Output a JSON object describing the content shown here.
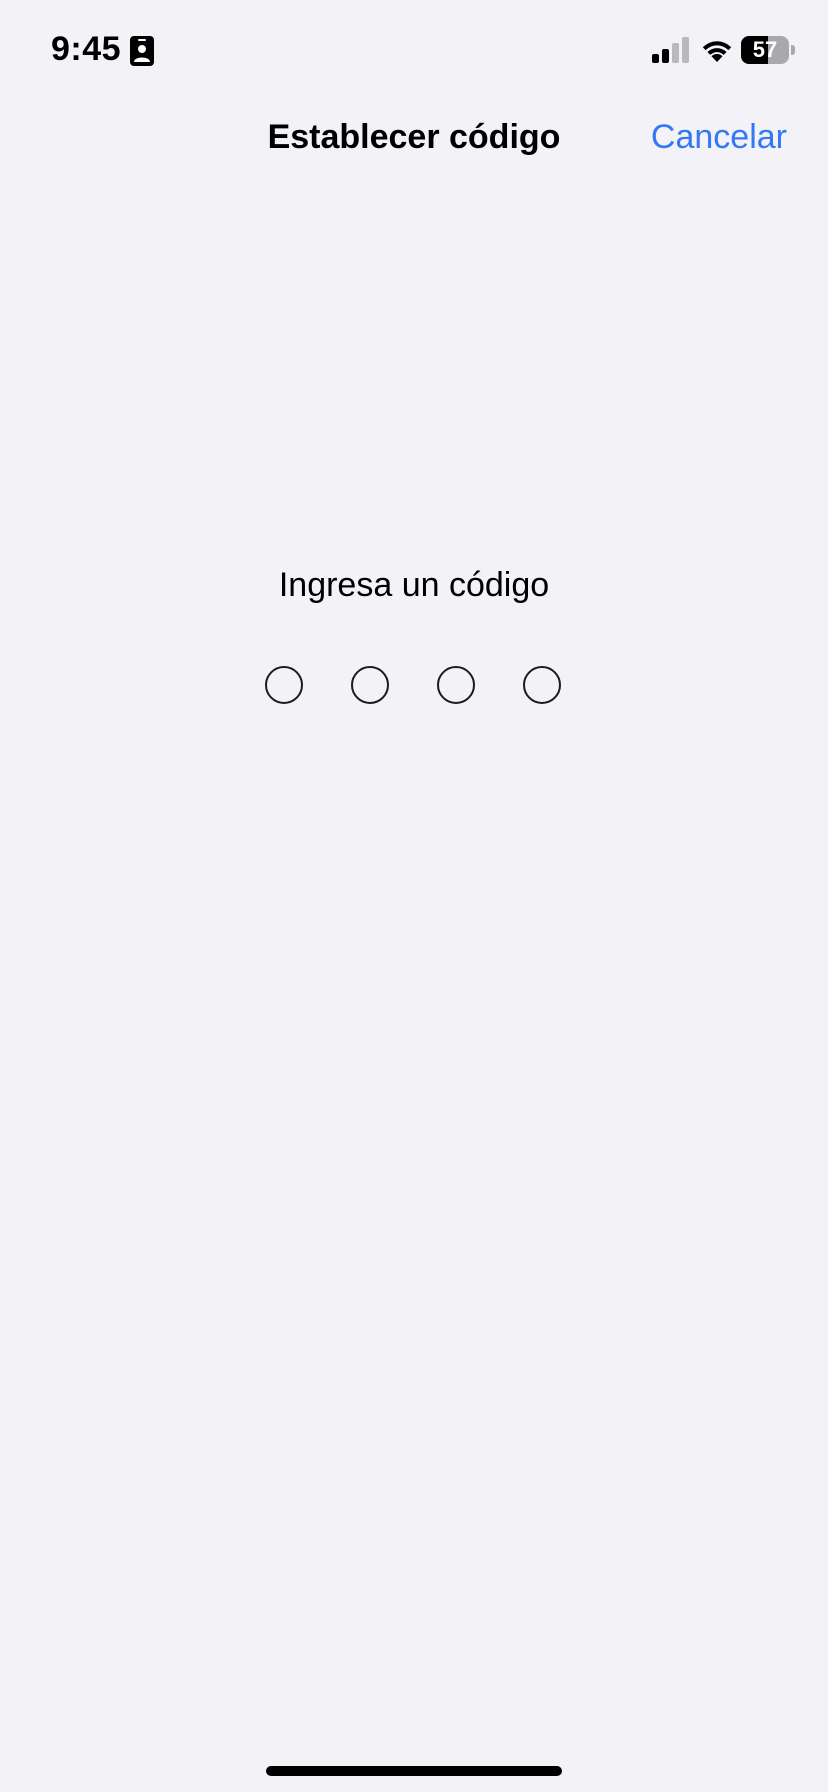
{
  "status_bar": {
    "time": "9:45",
    "battery_level": "57",
    "battery_fraction": 0.57,
    "signal_bars_active": 2,
    "signal_bars_total": 4,
    "icons": [
      "id-card-icon",
      "signal-icon",
      "wifi-icon",
      "battery-icon"
    ]
  },
  "nav": {
    "title": "Establecer código",
    "cancel_label": "Cancelar"
  },
  "passcode": {
    "prompt": "Ingresa un código",
    "digit_count": 4,
    "digits_entered": 0
  },
  "colors": {
    "background": "#f2f2f7",
    "accent": "#3478f6",
    "text": "#000000"
  }
}
